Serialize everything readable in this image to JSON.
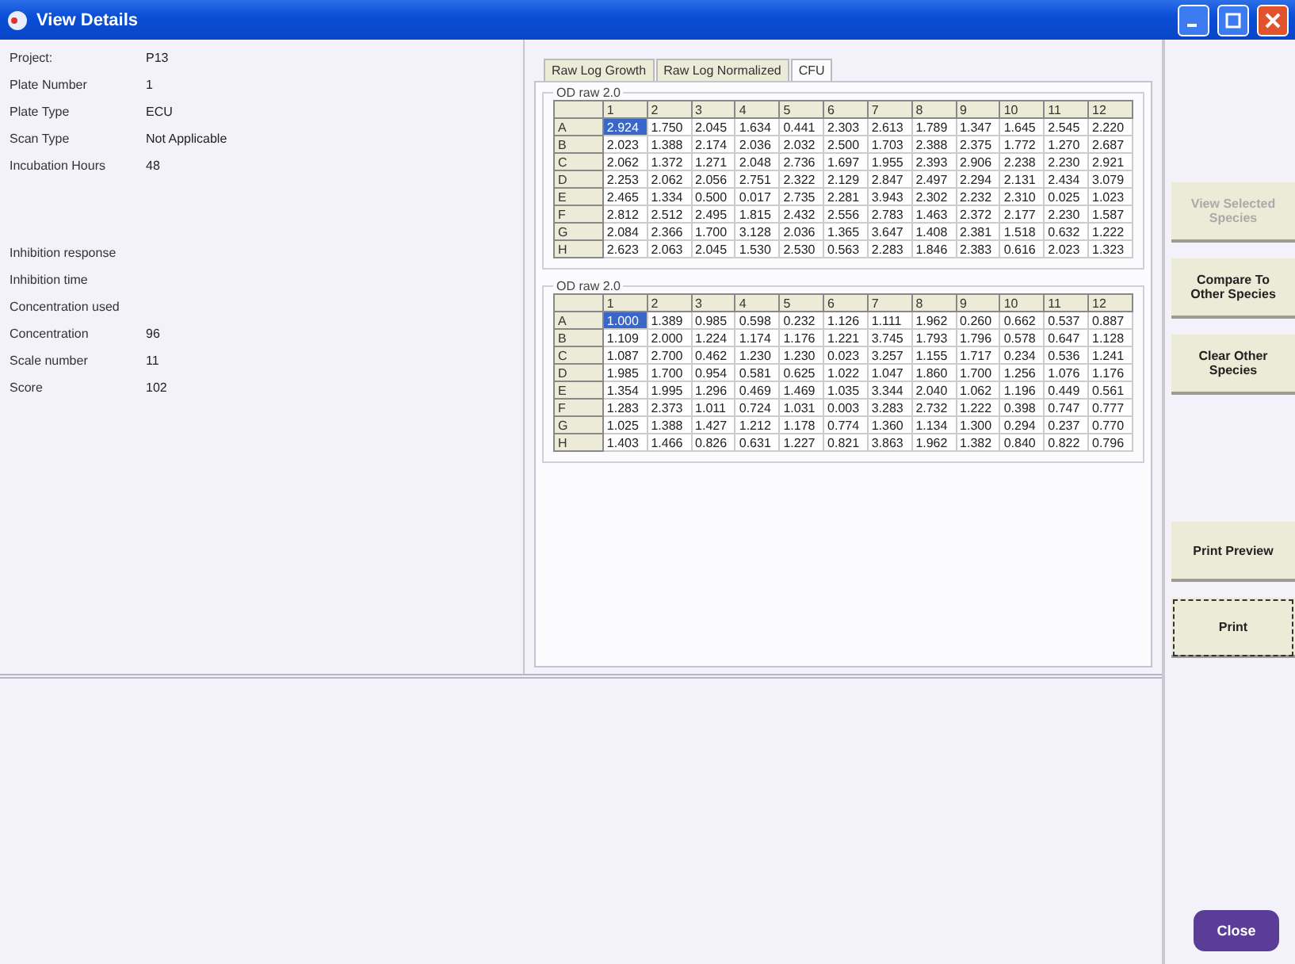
{
  "window": {
    "title": "View Details"
  },
  "details": [
    {
      "label": "Project:",
      "value": "P13"
    },
    {
      "label": "Plate Number",
      "value": "1"
    },
    {
      "label": "Plate Type",
      "value": "ECU"
    },
    {
      "label": "Scan Type",
      "value": "Not Applicable"
    },
    {
      "label": "Incubation Hours",
      "value": "48"
    }
  ],
  "results": [
    {
      "label": "Inhibition response"
    },
    {
      "label": "Inhibition time"
    },
    {
      "label": "Concentration used"
    },
    {
      "label": "Concentration",
      "value": "96"
    },
    {
      "label": "Scale number",
      "value": "11"
    },
    {
      "label": "Score",
      "value": "102"
    }
  ],
  "tabs": [
    {
      "label": "Raw Log Growth",
      "selected": false
    },
    {
      "label": "Raw Log Normalized",
      "selected": false
    },
    {
      "label": "CFU",
      "selected": true
    }
  ],
  "grids": [
    {
      "title": "OD raw 2.0",
      "columns": [
        "1",
        "2",
        "3",
        "4",
        "5",
        "6",
        "7",
        "8",
        "9",
        "10",
        "11",
        "12"
      ],
      "rows": [
        {
          "label": "A",
          "cells": [
            {
              "value": "2.924",
              "selected": true
            },
            {
              "value": "1.750",
              "selected": false
            },
            {
              "value": "2.045",
              "selected": false
            },
            {
              "value": "1.634",
              "selected": false
            },
            {
              "value": "0.441",
              "selected": false
            },
            {
              "value": "2.303",
              "selected": false
            },
            {
              "value": "2.613",
              "selected": false
            },
            {
              "value": "1.789",
              "selected": false
            },
            {
              "value": "1.347",
              "selected": false
            },
            {
              "value": "1.645",
              "selected": false
            },
            {
              "value": "2.545",
              "selected": false
            },
            {
              "value": "2.220",
              "selected": false
            }
          ]
        },
        {
          "label": "B",
          "cells": [
            {
              "value": "2.023",
              "selected": false
            },
            {
              "value": "1.388",
              "selected": false
            },
            {
              "value": "2.174",
              "selected": false
            },
            {
              "value": "2.036",
              "selected": false
            },
            {
              "value": "2.032",
              "selected": false
            },
            {
              "value": "2.500",
              "selected": false
            },
            {
              "value": "1.703",
              "selected": false
            },
            {
              "value": "2.388",
              "selected": false
            },
            {
              "value": "2.375",
              "selected": false
            },
            {
              "value": "1.772",
              "selected": false
            },
            {
              "value": "1.270",
              "selected": false
            },
            {
              "value": "2.687",
              "selected": false
            }
          ]
        },
        {
          "label": "C",
          "cells": [
            {
              "value": "2.062",
              "selected": false
            },
            {
              "value": "1.372",
              "selected": false
            },
            {
              "value": "1.271",
              "selected": false
            },
            {
              "value": "2.048",
              "selected": false
            },
            {
              "value": "2.736",
              "selected": false
            },
            {
              "value": "1.697",
              "selected": false
            },
            {
              "value": "1.955",
              "selected": false
            },
            {
              "value": "2.393",
              "selected": false
            },
            {
              "value": "2.906",
              "selected": false
            },
            {
              "value": "2.238",
              "selected": false
            },
            {
              "value": "2.230",
              "selected": false
            },
            {
              "value": "2.921",
              "selected": false
            }
          ]
        },
        {
          "label": "D",
          "cells": [
            {
              "value": "2.253",
              "selected": false
            },
            {
              "value": "2.062",
              "selected": false
            },
            {
              "value": "2.056",
              "selected": false
            },
            {
              "value": "2.751",
              "selected": false
            },
            {
              "value": "2.322",
              "selected": false
            },
            {
              "value": "2.129",
              "selected": false
            },
            {
              "value": "2.847",
              "selected": false
            },
            {
              "value": "2.497",
              "selected": false
            },
            {
              "value": "2.294",
              "selected": false
            },
            {
              "value": "2.131",
              "selected": false
            },
            {
              "value": "2.434",
              "selected": false
            },
            {
              "value": "3.079",
              "selected": false
            }
          ]
        },
        {
          "label": "E",
          "cells": [
            {
              "value": "2.465",
              "selected": false
            },
            {
              "value": "1.334",
              "selected": false
            },
            {
              "value": "0.500",
              "selected": false
            },
            {
              "value": "0.017",
              "selected": false
            },
            {
              "value": "2.735",
              "selected": false
            },
            {
              "value": "2.281",
              "selected": false
            },
            {
              "value": "3.943",
              "selected": false
            },
            {
              "value": "2.302",
              "selected": false
            },
            {
              "value": "2.232",
              "selected": false
            },
            {
              "value": "2.310",
              "selected": false
            },
            {
              "value": "0.025",
              "selected": false
            },
            {
              "value": "1.023",
              "selected": false
            }
          ]
        },
        {
          "label": "F",
          "cells": [
            {
              "value": "2.812",
              "selected": false
            },
            {
              "value": "2.512",
              "selected": false
            },
            {
              "value": "2.495",
              "selected": false
            },
            {
              "value": "1.815",
              "selected": false
            },
            {
              "value": "2.432",
              "selected": false
            },
            {
              "value": "2.556",
              "selected": false
            },
            {
              "value": "2.783",
              "selected": false
            },
            {
              "value": "1.463",
              "selected": false
            },
            {
              "value": "2.372",
              "selected": false
            },
            {
              "value": "2.177",
              "selected": false
            },
            {
              "value": "2.230",
              "selected": false
            },
            {
              "value": "1.587",
              "selected": false
            }
          ]
        },
        {
          "label": "G",
          "cells": [
            {
              "value": "2.084",
              "selected": false
            },
            {
              "value": "2.366",
              "selected": false
            },
            {
              "value": "1.700",
              "selected": false
            },
            {
              "value": "3.128",
              "selected": false
            },
            {
              "value": "2.036",
              "selected": false
            },
            {
              "value": "1.365",
              "selected": false
            },
            {
              "value": "3.647",
              "selected": false
            },
            {
              "value": "1.408",
              "selected": false
            },
            {
              "value": "2.381",
              "selected": false
            },
            {
              "value": "1.518",
              "selected": false
            },
            {
              "value": "0.632",
              "selected": false
            },
            {
              "value": "1.222",
              "selected": false
            }
          ]
        },
        {
          "label": "H",
          "cells": [
            {
              "value": "2.623",
              "selected": false
            },
            {
              "value": "2.063",
              "selected": false
            },
            {
              "value": "2.045",
              "selected": false
            },
            {
              "value": "1.530",
              "selected": false
            },
            {
              "value": "2.530",
              "selected": false
            },
            {
              "value": "0.563",
              "selected": false
            },
            {
              "value": "2.283",
              "selected": false
            },
            {
              "value": "1.846",
              "selected": false
            },
            {
              "value": "2.383",
              "selected": false
            },
            {
              "value": "0.616",
              "selected": false
            },
            {
              "value": "2.023",
              "selected": false
            },
            {
              "value": "1.323",
              "selected": false
            }
          ]
        }
      ]
    },
    {
      "title": "OD raw 2.0",
      "columns": [
        "1",
        "2",
        "3",
        "4",
        "5",
        "6",
        "7",
        "8",
        "9",
        "10",
        "11",
        "12"
      ],
      "rows": [
        {
          "label": "A",
          "cells": [
            {
              "value": "1.000",
              "selected": true
            },
            {
              "value": "1.389",
              "selected": false
            },
            {
              "value": "0.985",
              "selected": false
            },
            {
              "value": "0.598",
              "selected": false
            },
            {
              "value": "0.232",
              "selected": false
            },
            {
              "value": "1.126",
              "selected": false
            },
            {
              "value": "1.111",
              "selected": false
            },
            {
              "value": "1.962",
              "selected": false
            },
            {
              "value": "0.260",
              "selected": false
            },
            {
              "value": "0.662",
              "selected": false
            },
            {
              "value": "0.537",
              "selected": false
            },
            {
              "value": "0.887",
              "selected": false
            }
          ]
        },
        {
          "label": "B",
          "cells": [
            {
              "value": "1.109",
              "selected": false
            },
            {
              "value": "2.000",
              "selected": false
            },
            {
              "value": "1.224",
              "selected": false
            },
            {
              "value": "1.174",
              "selected": false
            },
            {
              "value": "1.176",
              "selected": false
            },
            {
              "value": "1.221",
              "selected": false
            },
            {
              "value": "3.745",
              "selected": false
            },
            {
              "value": "1.793",
              "selected": false
            },
            {
              "value": "1.796",
              "selected": false
            },
            {
              "value": "0.578",
              "selected": false
            },
            {
              "value": "0.647",
              "selected": false
            },
            {
              "value": "1.128",
              "selected": false
            }
          ]
        },
        {
          "label": "C",
          "cells": [
            {
              "value": "1.087",
              "selected": false
            },
            {
              "value": "2.700",
              "selected": false
            },
            {
              "value": "0.462",
              "selected": false
            },
            {
              "value": "1.230",
              "selected": false
            },
            {
              "value": "1.230",
              "selected": false
            },
            {
              "value": "0.023",
              "selected": false
            },
            {
              "value": "3.257",
              "selected": false
            },
            {
              "value": "1.155",
              "selected": false
            },
            {
              "value": "1.717",
              "selected": false
            },
            {
              "value": "0.234",
              "selected": false
            },
            {
              "value": "0.536",
              "selected": false
            },
            {
              "value": "1.241",
              "selected": false
            }
          ]
        },
        {
          "label": "D",
          "cells": [
            {
              "value": "1.985",
              "selected": false
            },
            {
              "value": "1.700",
              "selected": false
            },
            {
              "value": "0.954",
              "selected": false
            },
            {
              "value": "0.581",
              "selected": false
            },
            {
              "value": "0.625",
              "selected": false
            },
            {
              "value": "1.022",
              "selected": false
            },
            {
              "value": "1.047",
              "selected": false
            },
            {
              "value": "1.860",
              "selected": false
            },
            {
              "value": "1.700",
              "selected": false
            },
            {
              "value": "1.256",
              "selected": false
            },
            {
              "value": "1.076",
              "selected": false
            },
            {
              "value": "1.176",
              "selected": false
            }
          ]
        },
        {
          "label": "E",
          "cells": [
            {
              "value": "1.354",
              "selected": false
            },
            {
              "value": "1.995",
              "selected": false
            },
            {
              "value": "1.296",
              "selected": false
            },
            {
              "value": "0.469",
              "selected": false
            },
            {
              "value": "1.469",
              "selected": false
            },
            {
              "value": "1.035",
              "selected": false
            },
            {
              "value": "3.344",
              "selected": false
            },
            {
              "value": "2.040",
              "selected": false
            },
            {
              "value": "1.062",
              "selected": false
            },
            {
              "value": "1.196",
              "selected": false
            },
            {
              "value": "0.449",
              "selected": false
            },
            {
              "value": "0.561",
              "selected": false
            }
          ]
        },
        {
          "label": "F",
          "cells": [
            {
              "value": "1.283",
              "selected": false
            },
            {
              "value": "2.373",
              "selected": false
            },
            {
              "value": "1.011",
              "selected": false
            },
            {
              "value": "0.724",
              "selected": false
            },
            {
              "value": "1.031",
              "selected": false
            },
            {
              "value": "0.003",
              "selected": false
            },
            {
              "value": "3.283",
              "selected": false
            },
            {
              "value": "2.732",
              "selected": false
            },
            {
              "value": "1.222",
              "selected": false
            },
            {
              "value": "0.398",
              "selected": false
            },
            {
              "value": "0.747",
              "selected": false
            },
            {
              "value": "0.777",
              "selected": false
            }
          ]
        },
        {
          "label": "G",
          "cells": [
            {
              "value": "1.025",
              "selected": false
            },
            {
              "value": "1.388",
              "selected": false
            },
            {
              "value": "1.427",
              "selected": false
            },
            {
              "value": "1.212",
              "selected": false
            },
            {
              "value": "1.178",
              "selected": false
            },
            {
              "value": "0.774",
              "selected": false
            },
            {
              "value": "1.360",
              "selected": false
            },
            {
              "value": "1.134",
              "selected": false
            },
            {
              "value": "1.300",
              "selected": false
            },
            {
              "value": "0.294",
              "selected": false
            },
            {
              "value": "0.237",
              "selected": false
            },
            {
              "value": "0.770",
              "selected": false
            }
          ]
        },
        {
          "label": "H",
          "cells": [
            {
              "value": "1.403",
              "selected": false
            },
            {
              "value": "1.466",
              "selected": false
            },
            {
              "value": "0.826",
              "selected": false
            },
            {
              "value": "0.631",
              "selected": false
            },
            {
              "value": "1.227",
              "selected": false
            },
            {
              "value": "0.821",
              "selected": false
            },
            {
              "value": "3.863",
              "selected": false
            },
            {
              "value": "1.962",
              "selected": false
            },
            {
              "value": "1.382",
              "selected": false
            },
            {
              "value": "0.840",
              "selected": false
            },
            {
              "value": "0.822",
              "selected": false
            },
            {
              "value": "0.796",
              "selected": false
            }
          ]
        }
      ]
    }
  ],
  "action_groups": [
    [
      {
        "label": "View Selected Species",
        "disabled": true,
        "focused": false
      },
      {
        "label": "Compare To Other Species",
        "disabled": false,
        "focused": false
      },
      {
        "label": "Clear Other Species",
        "disabled": false,
        "focused": false
      }
    ],
    [
      {
        "label": "Print Preview",
        "disabled": false,
        "focused": false
      },
      {
        "label": "Print",
        "disabled": false,
        "focused": true
      }
    ]
  ],
  "close_button": {
    "label": "Close"
  }
}
